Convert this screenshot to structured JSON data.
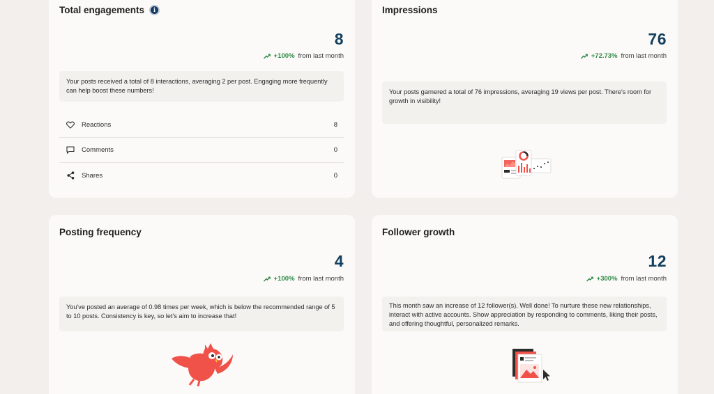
{
  "cards": {
    "engagements": {
      "title": "Total engagements",
      "value": "8",
      "change": "+100%",
      "change_suffix": "from last month",
      "note": "Your posts received a total of 8 interactions, averaging 2 per post. Engaging more frequently can help boost these numbers!",
      "metrics": [
        {
          "label": "Reactions",
          "value": "8",
          "icon": "heart-icon"
        },
        {
          "label": "Comments",
          "value": "0",
          "icon": "comment-icon"
        },
        {
          "label": "Shares",
          "value": "0",
          "icon": "share-icon"
        }
      ]
    },
    "impressions": {
      "title": "Impressions",
      "value": "76",
      "change": "+72.73%",
      "change_suffix": "from last month",
      "note": "Your posts garnered a total of 76 impressions, averaging 19 views per post. There's room for growth in visibility!"
    },
    "posting": {
      "title": "Posting frequency",
      "value": "4",
      "change": "+100%",
      "change_suffix": "from last month",
      "note": "You've posted an average of 0.98 times per week, which is below the recommended range of 5 to 10 posts. Consistency is key, so let's aim to increase that!"
    },
    "followers": {
      "title": "Follower growth",
      "value": "12",
      "change": "+300%",
      "change_suffix": "from last month",
      "note": "This month saw an increase of 12 follower(s). Well done! To nurture these new relationships, interact with active accounts. Show appreciation by responding to comments, liking their posts, and offering thoughtful, personalized remarks."
    }
  },
  "colors": {
    "background": "#f2efec",
    "card": "#fbfaf8",
    "value": "#14405f",
    "positive": "#2e8a46",
    "accent": "#f0524a"
  }
}
